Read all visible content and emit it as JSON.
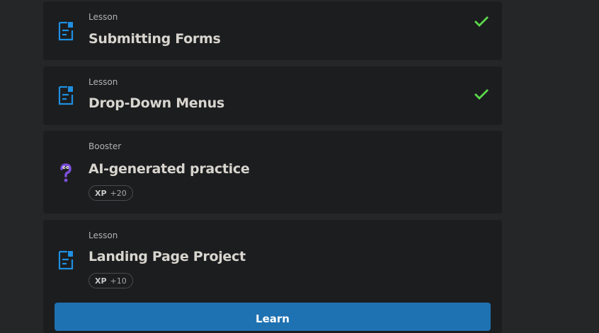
{
  "colors": {
    "background": "#252628",
    "card": "#1c1d1f",
    "lesson_icon": "#1f8fe0",
    "check": "#5ad84a",
    "booster_icon": "#7b4fd8",
    "button": "#1f72b1"
  },
  "items": [
    {
      "kind": "Lesson",
      "title": "Submitting Forms",
      "icon": "lesson-icon",
      "completed": true
    },
    {
      "kind": "Lesson",
      "title": "Drop-Down Menus",
      "icon": "lesson-icon",
      "completed": true
    },
    {
      "kind": "Booster",
      "title": "AI-generated practice",
      "icon": "question-mark-icon",
      "completed": false,
      "xp_label": "XP",
      "xp_value": "+20"
    },
    {
      "kind": "Lesson",
      "title": "Landing Page Project",
      "icon": "lesson-icon",
      "completed": false,
      "xp_label": "XP",
      "xp_value": "+10"
    }
  ],
  "learn_button": "Learn"
}
